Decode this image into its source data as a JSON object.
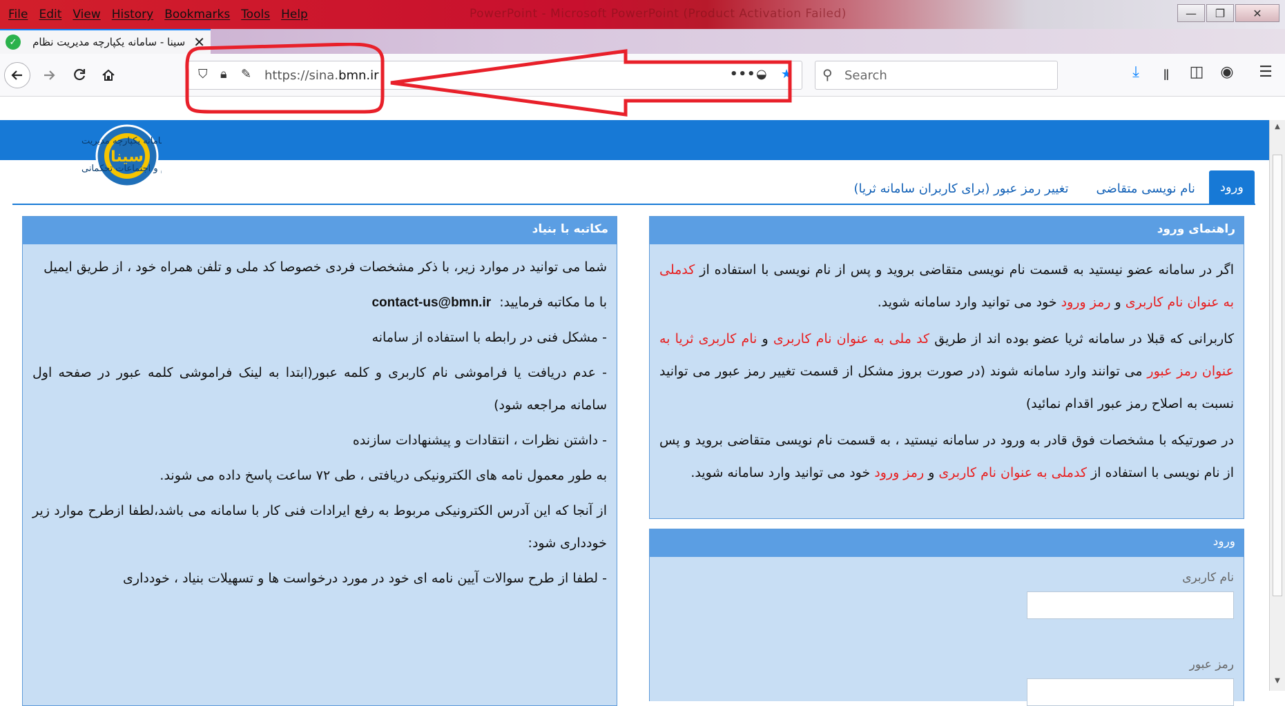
{
  "browser": {
    "window_title": "PowerPoint - Microsoft PowerPoint (Product Activation Failed)",
    "menu": [
      "File",
      "Edit",
      "View",
      "History",
      "Bookmarks",
      "Tools",
      "Help"
    ],
    "window_controls": {
      "minimize": "—",
      "maximize": "❐",
      "close": "✕"
    },
    "tab": {
      "title": "سینا - سامانه یکپارچه مدیریت نظام",
      "close": "✕"
    },
    "url": {
      "prefix": "https://sina.",
      "domain": "bmn.ir"
    },
    "search": {
      "placeholder": "Search"
    },
    "icons": [
      "back-icon",
      "forward-icon",
      "reload-icon",
      "home-icon",
      "shield-icon",
      "lock-icon",
      "permissions-icon",
      "page-actions-icon",
      "pocket-icon",
      "bookmark-star-icon",
      "download-icon",
      "library-icon",
      "sidebar-icon",
      "account-icon",
      "menu-icon"
    ],
    "accent_color": "#0a84ff",
    "annotation_color": "#e8202a"
  },
  "site": {
    "logo": {
      "line1": "سامانه یکپارچه مدیریت",
      "line2": "نظام و اجتماعات تحکمانی",
      "brand": "سینا"
    },
    "header_color": "#1779d6",
    "nav_tabs": [
      {
        "label": "ورود",
        "active": true
      },
      {
        "label": "نام نویسی متقاضی",
        "active": false
      },
      {
        "label": "تغییر رمز عبور (برای کاربران سامانه ثریا)",
        "active": false
      }
    ],
    "guide_panel": {
      "title": "راهنمای ورود",
      "p1": [
        {
          "t": "اگر در سامانه عضو نیستید به قسمت نام نویسی متقاضی بروید و پس از نام نویسی با استفاده از ",
          "c": "n"
        },
        {
          "t": "کدملی به عنوان نام کاربری",
          "c": "r"
        },
        {
          "t": " و ",
          "c": "n"
        },
        {
          "t": "رمز ورود",
          "c": "r"
        },
        {
          "t": " خود می توانید وارد سامانه شوید.",
          "c": "n"
        }
      ],
      "p2": [
        {
          "t": "کاربرانی که قبلا در سامانه ثریا عضو بوده اند از طریق ",
          "c": "n"
        },
        {
          "t": "کد ملی به عنوان نام کاربری",
          "c": "r"
        },
        {
          "t": " و ",
          "c": "n"
        },
        {
          "t": "نام کاربری ثریا به عنوان رمز عبور",
          "c": "r"
        },
        {
          "t": " می توانند وارد سامانه شوند (در صورت بروز مشکل از قسمت تغییر رمز عبور می توانید نسبت به اصلاح رمز عبور اقدام نمائید)",
          "c": "n"
        }
      ],
      "p3": [
        {
          "t": "در صورتیکه با مشخصات فوق قادر به ورود در سامانه نیستید ، به قسمت نام نویسی متقاضی بروید و پس از نام نویسی با استفاده از ",
          "c": "n"
        },
        {
          "t": "کدملی به عنوان نام کاربری",
          "c": "r"
        },
        {
          "t": " و ",
          "c": "n"
        },
        {
          "t": "رمز ورود",
          "c": "r"
        },
        {
          "t": " خود می توانید وارد سامانه شوید.",
          "c": "n"
        }
      ]
    },
    "login_panel": {
      "title": "ورود",
      "username_label": "نام کاربری",
      "password_label": "رمز عبور",
      "username_value": "",
      "password_value": ""
    },
    "contact_panel": {
      "title": "مکاتبه با بنیاد",
      "intro": "شما می توانید در موارد زیر، با ذکر مشخصات فردی خصوصا کد ملی و تلفن همراه خود ، از طریق ایمیل",
      "email": "contact-us@bmn.ir",
      "email_suffix": "با ما مکاتبه فرمایید:",
      "items": [
        "- مشکل فنی در رابطه با استفاده از سامانه",
        "- عدم دریافت یا فراموشی نام کاربری و کلمه عبور(ابتدا به لینک فراموشی کلمه عبور در صفحه اول سامانه مراجعه شود)",
        "- داشتن نظرات ، انتقادات و پیشنهادات سازنده"
      ],
      "p_response": "به طور معمول نامه های الکترونیکی دریافتی ، طی ۷۲ ساعت پاسخ داده می شوند.",
      "p_note": "از آنجا که این آدرس الکترونیکی مربوط به رفع ایرادات فنی کار با سامانه می باشد،لطفا ازطرح موارد زیر خودداری شود:",
      "p_last": "- لطفا از طرح سوالات آیین نامه ای خود در مورد درخواست ها و تسهیلات بنیاد ، خودداری"
    }
  }
}
